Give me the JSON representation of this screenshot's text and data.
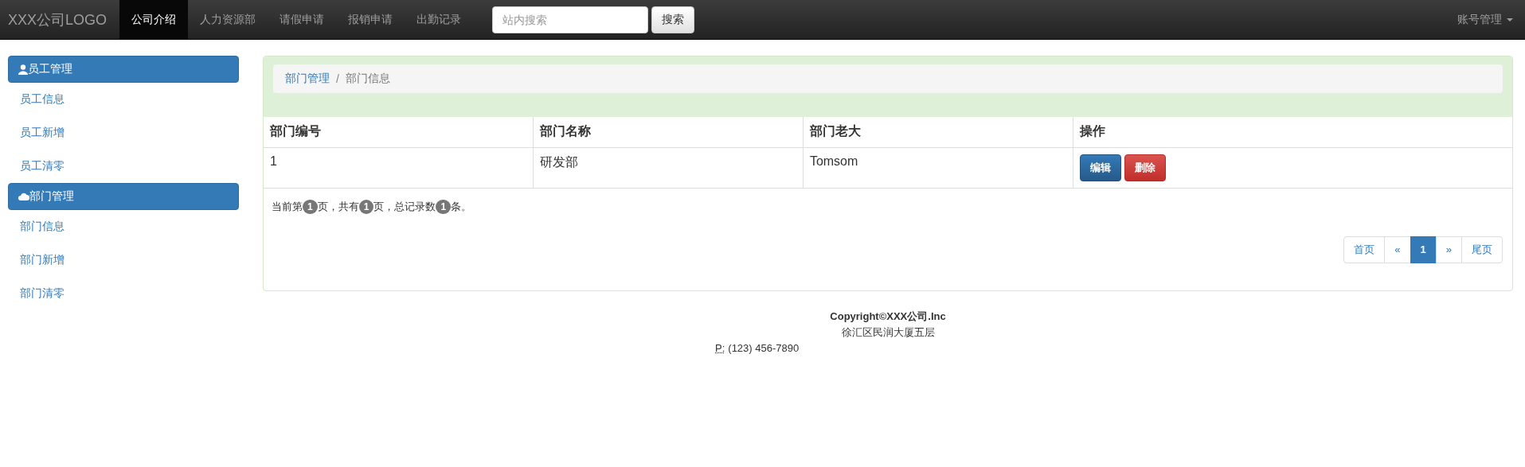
{
  "navbar": {
    "brand": "XXX公司LOGO",
    "items": [
      {
        "label": "公司介绍",
        "selected": true
      },
      {
        "label": "人力资源部",
        "selected": false
      },
      {
        "label": "请假申请",
        "selected": false
      },
      {
        "label": "报销申请",
        "selected": false
      },
      {
        "label": "出勤记录",
        "selected": false
      }
    ],
    "search": {
      "placeholder": "站内搜索",
      "button": "搜索"
    },
    "account": "账号管理"
  },
  "sidebar": {
    "groups": [
      {
        "title": "员工管理",
        "kind": "user",
        "items": [
          "员工信息",
          "员工新增",
          "员工清零"
        ]
      },
      {
        "title": "部门管理",
        "kind": "cloud",
        "items": [
          "部门信息",
          "部门新增",
          "部门清零"
        ]
      }
    ]
  },
  "breadcrumb": {
    "separator": "/",
    "items": [
      {
        "label": "部门管理",
        "kind": "link"
      },
      {
        "label": "部门信息",
        "kind": "current"
      }
    ]
  },
  "table": {
    "columns": [
      "部门编号",
      "部门名称",
      "部门老大",
      "操作"
    ],
    "rows": [
      {
        "cells": [
          "1",
          "研发部",
          "Tomsom"
        ],
        "actions": [
          {
            "label": "编辑",
            "kind": "primary"
          },
          {
            "label": "删除",
            "kind": "danger"
          }
        ]
      }
    ]
  },
  "pagination_info": [
    {
      "kind": "text",
      "text": "当前第"
    },
    {
      "kind": "badge",
      "text": "1"
    },
    {
      "kind": "text",
      "text": "页，共有"
    },
    {
      "kind": "badge",
      "text": "1"
    },
    {
      "kind": "text",
      "text": "页，总记录数"
    },
    {
      "kind": "badge",
      "text": "1"
    },
    {
      "kind": "text",
      "text": "条。"
    }
  ],
  "pagination": [
    {
      "label": "首页",
      "selected": false
    },
    {
      "label": "«",
      "selected": false
    },
    {
      "label": "1",
      "selected": true
    },
    {
      "label": "»",
      "selected": false
    },
    {
      "label": "尾页",
      "selected": false
    }
  ],
  "footer": {
    "copyright": "Copyright©XXX公司.Inc",
    "address": "徐汇区民润大厦五层",
    "phone_label": "P:",
    "phone": "(123) 456-7890"
  }
}
